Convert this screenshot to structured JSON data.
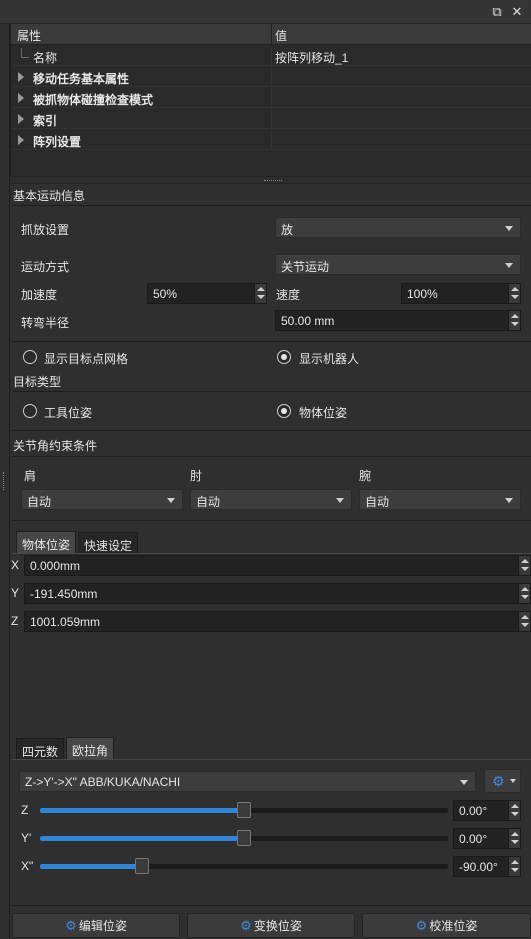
{
  "property_tree": {
    "col_property": "属性",
    "col_value": "值",
    "rows": [
      {
        "label": "名称",
        "value": "按阵列移动_1",
        "expandable": false,
        "bold": false
      },
      {
        "label": "移动任务基本属性",
        "value": "",
        "expandable": true,
        "bold": true
      },
      {
        "label": "被抓物体碰撞检查模式",
        "value": "",
        "expandable": true,
        "bold": true
      },
      {
        "label": "索引",
        "value": "",
        "expandable": true,
        "bold": true
      },
      {
        "label": "阵列设置",
        "value": "",
        "expandable": true,
        "bold": true
      }
    ]
  },
  "basic_motion": {
    "section_title": "基本运动信息",
    "pick_place_label": "抓放设置",
    "pick_place_value": "放",
    "motion_mode_label": "运动方式",
    "motion_mode_value": "关节运动",
    "acceleration_label": "加速度",
    "acceleration_value": "50%",
    "speed_label": "速度",
    "speed_value": "100%",
    "blend_radius_label": "转弯半径",
    "blend_radius_value": "50.00 mm",
    "show_grid_label": "显示目标点网格",
    "show_grid_selected": false,
    "show_robot_label": "显示机器人",
    "show_robot_selected": true
  },
  "target_type": {
    "section_title": "目标类型",
    "tool_pose_label": "工具位姿",
    "tool_pose_selected": false,
    "object_pose_label": "物体位姿",
    "object_pose_selected": true
  },
  "joint_constraints": {
    "section_title": "关节角约束条件",
    "shoulder_label": "肩",
    "shoulder_value": "自动",
    "elbow_label": "肘",
    "elbow_value": "自动",
    "wrist_label": "腕",
    "wrist_value": "自动"
  },
  "pose_tabs": {
    "tab_object_pose": "物体位姿",
    "tab_quick_settings": "快速设定",
    "active": "物体位姿",
    "x_label": "X",
    "x_value": "0.000mm",
    "y_label": "Y",
    "y_value": "-191.450mm",
    "z_label": "Z",
    "z_value": "1001.059mm"
  },
  "rotation": {
    "tab_quaternion": "四元数",
    "tab_euler": "欧拉角",
    "active": "欧拉角",
    "convention_value": "Z->Y'->X\" ABB/KUKA/NACHI",
    "settings_icon": "gear-icon",
    "z_label": "Z",
    "z_value": "0.00°",
    "z_level": 0.5,
    "y_label": "Y'",
    "y_value": "0.00°",
    "y_level": 0.5,
    "x_label": "X\"",
    "x_value": "-90.00°",
    "x_level": 0.25
  },
  "bottom_buttons": {
    "edit_pose": "编辑位姿",
    "transform_pose": "变换位姿",
    "calibrate_pose": "校准位姿"
  },
  "colors": {
    "accent": "#2f86d8",
    "background": "#2f2f2f"
  }
}
